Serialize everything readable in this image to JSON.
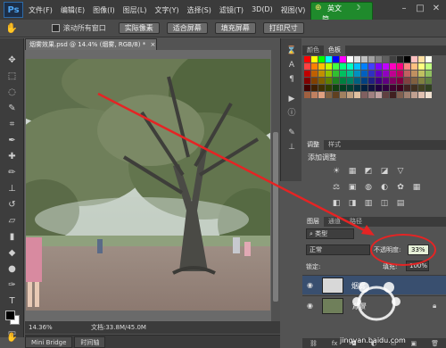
{
  "app": {
    "logo": "Ps"
  },
  "menu": [
    "文件(F)",
    "编辑(E)",
    "图像(I)",
    "图层(L)",
    "文字(Y)",
    "选择(S)",
    "滤镜(T)",
    "3D(D)",
    "视图(V)"
  ],
  "ime": {
    "lang": "英文",
    "mode": "简",
    "extra": "拼"
  },
  "options_bar": {
    "checkbox_label": "滚动所有窗口",
    "checked": false,
    "buttons": [
      "实际像素",
      "适合屏幕",
      "填充屏幕",
      "打印尺寸"
    ]
  },
  "document": {
    "tab_title": "烟雾效果.psd @ 14.4% (烟雾, RGB/8) *",
    "tab_close": "×",
    "zoom": "14.36%",
    "doc_info": "文档:33.8M/45.0M"
  },
  "bottom_tabs": [
    "Mini Bridge",
    "时间轴"
  ],
  "panels": {
    "swatches_tabs": [
      "颜色",
      "色板"
    ],
    "swatch_colors": [
      [
        "#ff0000",
        "#ffff00",
        "#00ff00",
        "#00ffff",
        "#0000ff",
        "#ff00ff",
        "#ffffff",
        "#e0e0e0",
        "#c0c0c0",
        "#a0a0a0",
        "#808080",
        "#606060",
        "#404040",
        "#202020",
        "#000000",
        "#ffc0c0",
        "#ffe0a0",
        "#fffff0"
      ],
      [
        "#ff4040",
        "#ff8000",
        "#ffc000",
        "#c0ff00",
        "#40ff40",
        "#00ff80",
        "#00ffc0",
        "#00c0ff",
        "#0080ff",
        "#4040ff",
        "#8000ff",
        "#c000ff",
        "#ff00c0",
        "#ff0080",
        "#ff8080",
        "#ffc080",
        "#ffff80",
        "#c0ff80"
      ],
      [
        "#c00000",
        "#c06000",
        "#c09000",
        "#90c000",
        "#30c030",
        "#00c060",
        "#00c090",
        "#0090c0",
        "#0060c0",
        "#3030c0",
        "#6000c0",
        "#9000c0",
        "#c00090",
        "#c00060",
        "#c06060",
        "#c09060",
        "#c0c060",
        "#90c060"
      ],
      [
        "#800000",
        "#804000",
        "#806000",
        "#608000",
        "#208020",
        "#008040",
        "#008060",
        "#006080",
        "#004080",
        "#202080",
        "#400080",
        "#600080",
        "#800060",
        "#800040",
        "#804040",
        "#806040",
        "#808040",
        "#608040"
      ],
      [
        "#400000",
        "#402000",
        "#403000",
        "#304000",
        "#104010",
        "#004020",
        "#004030",
        "#003040",
        "#002040",
        "#101040",
        "#200040",
        "#300040",
        "#400030",
        "#400020",
        "#402020",
        "#403020",
        "#404020",
        "#304020"
      ],
      [
        "#a06040",
        "#c08060",
        "#e0a080",
        "#806040",
        "#604020",
        "#a08060",
        "#c0a080",
        "#e0c0a0",
        "#806060",
        "#a08080",
        "#c0a0a0",
        "#604040",
        "#402020",
        "#806050",
        "#a08070",
        "#c0a090",
        "#e0c0b0",
        "#f0e0d0"
      ]
    ],
    "adjust_tabs": [
      "调整",
      "样式"
    ],
    "adjust_title": "添加调整",
    "adjust_icons_row1": [
      "☀",
      "▦",
      "◩",
      "◪",
      "▽"
    ],
    "adjust_icons_row2": [
      "⚖",
      "▣",
      "◍",
      "◐",
      "✿",
      "▦"
    ],
    "adjust_icons_row3": [
      "◧",
      "◨",
      "▥",
      "◫",
      "▤"
    ],
    "layers_tabs": [
      "图层",
      "通道",
      "路径"
    ],
    "kind_label": "类型",
    "blend_mode": "正常",
    "opacity_label": "不透明度:",
    "opacity_value": "33%",
    "lock_label": "锁定:",
    "fill_label": "填充:",
    "fill_value": "100%",
    "layers": [
      {
        "name": "烟雾",
        "selected": true
      },
      {
        "name": "背景",
        "selected": false
      }
    ]
  },
  "watermark": {
    "text": "jingyan.baidu.com"
  },
  "colors": {
    "annotation": "#e52424",
    "selected_layer": "#394f6f"
  }
}
